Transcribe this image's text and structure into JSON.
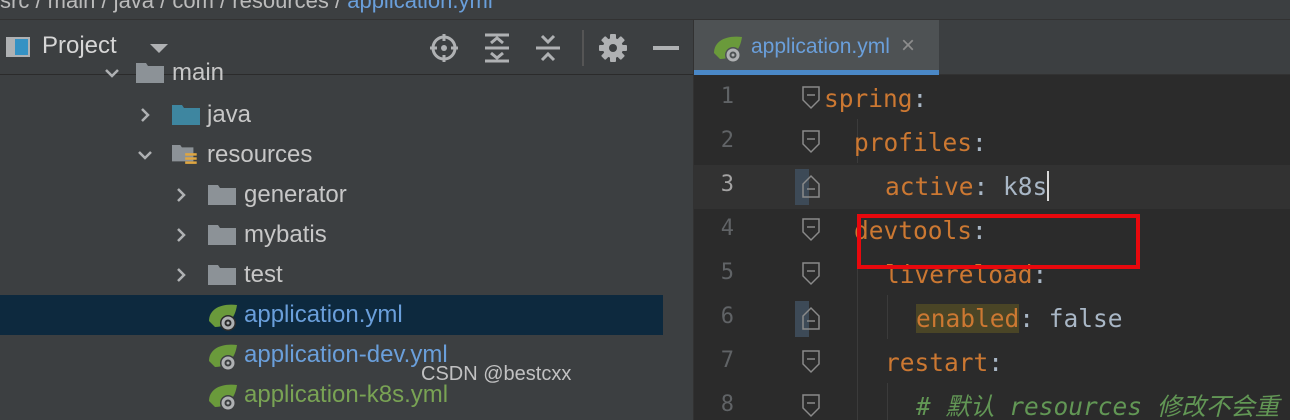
{
  "breadcrumb": {
    "text": "src  /  main  /  java  /  com  /  resources  / ",
    "last": "application.yml"
  },
  "project_panel": {
    "title": "Project",
    "toolbar": {
      "locate": "crosshair-icon",
      "expand": "expand-all-icon",
      "collapse": "collapse-all-icon",
      "settings": "gear-icon",
      "hide": "minimize-icon"
    }
  },
  "tree": {
    "items": [
      {
        "label": "main",
        "type": "folder"
      },
      {
        "label": "java",
        "type": "source-folder",
        "collapsed": true
      },
      {
        "label": "resources",
        "type": "resources-folder",
        "expanded": true
      },
      {
        "label": "generator",
        "type": "folder",
        "collapsed": true
      },
      {
        "label": "mybatis",
        "type": "folder",
        "collapsed": true
      },
      {
        "label": "test",
        "type": "folder",
        "collapsed": true
      },
      {
        "label": "application.yml",
        "type": "spring-yml",
        "selected": true
      },
      {
        "label": "application-dev.yml",
        "type": "spring-yml"
      },
      {
        "label": "application-k8s.yml",
        "type": "spring-yml"
      }
    ]
  },
  "editor": {
    "tab": {
      "label": "application.yml",
      "close": "×"
    },
    "line_numbers": [
      "1",
      "2",
      "3",
      "4",
      "5",
      "6",
      "7",
      "8"
    ],
    "current_line": "3",
    "code": {
      "l1_key": "spring",
      "l1_colon": ":",
      "l2_key": "profiles",
      "l2_colon": ":",
      "l3_key": "active",
      "l3_rest": ": k8s",
      "l4_key": "devtools",
      "l4_colon": ":",
      "l5_key": "livereload",
      "l5_colon": ":",
      "l6_key": "enabled",
      "l6_rest": ": false",
      "l7_key": "restart",
      "l7_colon": ":",
      "l8_comment": "# 默认 resources 修改不会重"
    }
  },
  "watermark": "CSDN @bestcxx",
  "colors": {
    "keyword": "#cc7832",
    "value": "#a9b7c6",
    "comment": "#629755",
    "highlight_box": "#e8080d",
    "selection": "#0d293e"
  }
}
